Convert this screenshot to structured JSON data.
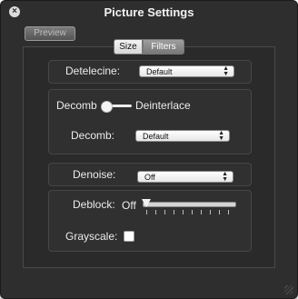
{
  "window": {
    "title": "Picture Settings",
    "close_symbol": "×"
  },
  "toolbar": {
    "preview_label": "Preview"
  },
  "tabs": [
    {
      "label": "Size",
      "selected": false
    },
    {
      "label": "Filters",
      "selected": true
    }
  ],
  "filters": {
    "detelecine": {
      "label": "Detelecine:",
      "value": "Default"
    },
    "decomb_toggle": {
      "left_label": "Decomb",
      "right_label": "Deinterlace",
      "state": "Decomb"
    },
    "decomb": {
      "label": "Decomb:",
      "value": "Default"
    },
    "denoise": {
      "label": "Denoise:",
      "value": "Off"
    },
    "deblock": {
      "label": "Deblock:",
      "value_text": "Off",
      "level": 0
    },
    "grayscale": {
      "label": "Grayscale:",
      "checked": false
    }
  },
  "colors": {
    "window_bg": "#2e2e2e",
    "text": "#ececec"
  },
  "icons": {
    "select_arrows": "▲▼"
  }
}
